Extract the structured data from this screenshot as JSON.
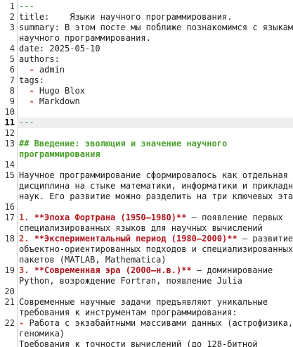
{
  "editor": {
    "lines": [
      {
        "n": "1",
        "rows": [
          [
            {
              "t": "---",
              "c": "dash"
            }
          ]
        ]
      },
      {
        "n": "2",
        "rows": [
          [
            {
              "t": "title:    Языки научного программирования.",
              "c": "frontm"
            }
          ]
        ]
      },
      {
        "n": "3",
        "rows": [
          [
            {
              "t": "summary: В этом посте мы поближе познакомимся с языками",
              "c": "frontm"
            }
          ],
          [
            {
              "t": "научного программирования.",
              "c": "frontm"
            }
          ]
        ]
      },
      {
        "n": "4",
        "rows": [
          [
            {
              "t": "date: 2025-05-10",
              "c": "frontm"
            }
          ]
        ]
      },
      {
        "n": "5",
        "rows": [
          [
            {
              "t": "authors:",
              "c": "frontm"
            }
          ]
        ]
      },
      {
        "n": "6",
        "rows": [
          [
            {
              "t": "  - ",
              "c": "marker"
            },
            {
              "t": "admin",
              "c": "frontm"
            }
          ]
        ]
      },
      {
        "n": "7",
        "rows": [
          [
            {
              "t": "tags:",
              "c": "frontm"
            }
          ]
        ]
      },
      {
        "n": "8",
        "rows": [
          [
            {
              "t": "  - ",
              "c": "marker"
            },
            {
              "t": "Hugo Blox",
              "c": "frontm"
            }
          ]
        ]
      },
      {
        "n": "9",
        "rows": [
          [
            {
              "t": "  - ",
              "c": "marker"
            },
            {
              "t": "Markdown",
              "c": "frontm"
            }
          ]
        ]
      },
      {
        "n": "10",
        "rows": [
          [
            {
              "t": "",
              "c": "plain"
            }
          ]
        ]
      },
      {
        "n": "11",
        "active": true,
        "rows": [
          [
            {
              "t": "---",
              "c": "dash"
            }
          ]
        ]
      },
      {
        "n": "12",
        "rows": [
          [
            {
              "t": "",
              "c": "plain"
            }
          ]
        ]
      },
      {
        "n": "13",
        "rows": [
          [
            {
              "t": "## Введение: эволюция и значение научного",
              "c": "heading"
            }
          ],
          [
            {
              "t": "программирования",
              "c": "heading"
            }
          ]
        ]
      },
      {
        "n": "14",
        "rows": [
          [
            {
              "t": "",
              "c": "plain"
            }
          ]
        ]
      },
      {
        "n": "15",
        "rows": [
          [
            {
              "t": "Научное программирование сформировалось как отдельная",
              "c": "plain"
            }
          ],
          [
            {
              "t": "дисциплина на стыке математики, информатики и прикладных",
              "c": "plain"
            }
          ],
          [
            {
              "t": "наук. Его развитие можно разделить на три ключевых этапа:",
              "c": "plain"
            }
          ]
        ]
      },
      {
        "n": "16",
        "rows": [
          [
            {
              "t": "",
              "c": "plain"
            }
          ]
        ]
      },
      {
        "n": "17",
        "rows": [
          [
            {
              "t": "1. ",
              "c": "marker"
            },
            {
              "t": "**Эпоха Фортрана (1950–1980)**",
              "c": "bold-red"
            },
            {
              "t": " – появление первых",
              "c": "plain"
            }
          ],
          [
            {
              "t": "специализированных языков для научных вычислений",
              "c": "plain"
            }
          ]
        ]
      },
      {
        "n": "18",
        "rows": [
          [
            {
              "t": "2. ",
              "c": "marker"
            },
            {
              "t": "**Экспериментальный период (1980–2000)**",
              "c": "bold-red"
            },
            {
              "t": " – развитие",
              "c": "plain"
            }
          ],
          [
            {
              "t": "объектно-ориентированных подходов и специализированных",
              "c": "plain"
            }
          ],
          [
            {
              "t": "пакетов (MATLAB, Mathematica)",
              "c": "plain"
            }
          ]
        ]
      },
      {
        "n": "19",
        "rows": [
          [
            {
              "t": "3. ",
              "c": "marker"
            },
            {
              "t": "**Современная эра (2000–н.в.)**",
              "c": "bold-red"
            },
            {
              "t": " – доминирование",
              "c": "plain"
            }
          ],
          [
            {
              "t": "Python, возрождение Fortran, появление Julia",
              "c": "plain"
            }
          ]
        ]
      },
      {
        "n": "20",
        "rows": [
          [
            {
              "t": "",
              "c": "plain"
            }
          ]
        ]
      },
      {
        "n": "21",
        "rows": [
          [
            {
              "t": "Современные научные задачи предъявляют уникальные",
              "c": "plain"
            }
          ],
          [
            {
              "t": "требования к инструментам программирования:",
              "c": "plain"
            }
          ]
        ]
      },
      {
        "n": "22",
        "rows": [
          [
            {
              "t": "- ",
              "c": "marker"
            },
            {
              "t": "Работа с экзабайтными массивами данных (астрофизика,",
              "c": "plain"
            }
          ],
          [
            {
              "t": "геномика)",
              "c": "plain"
            }
          ],
          [
            {
              "t": "Требования к точности вычислений (до 128-битной",
              "c": "plain"
            }
          ]
        ]
      }
    ]
  }
}
